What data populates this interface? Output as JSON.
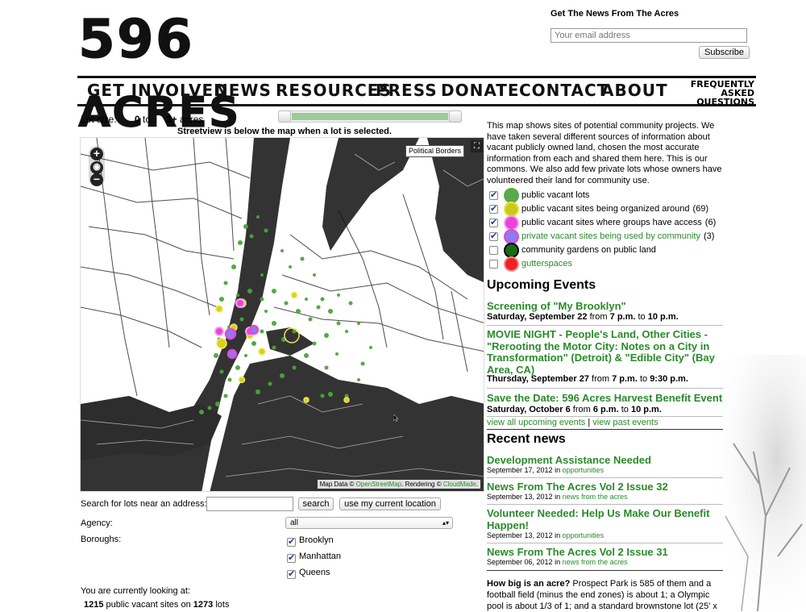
{
  "header": {
    "logo": {
      "number": "596",
      "word": "ACRES"
    },
    "newsletter_title": "Get The News From The Acres",
    "email_placeholder": "Your email address",
    "subscribe_label": "Subscribe"
  },
  "nav": {
    "items": [
      "GET INVOLVED",
      "NEWS",
      "RESOURCES",
      "PRESS",
      "DONATE",
      "CONTACT",
      "ABOUT"
    ],
    "faq_line1": "FREQUENTLY",
    "faq_line2": "ASKED QUESTIONS"
  },
  "lot_size": {
    "label": "Lot size:",
    "min_value": "0",
    "to_text": "to",
    "max_value": "3+",
    "units": "acres",
    "streetview_note": "Streetview is below the map when a lot is selected."
  },
  "map": {
    "political_borders_label": "Political Borders",
    "zoom_in": "+",
    "zoom_out": "−",
    "attribution_prefix": "Map Data ©",
    "attribution_osm": "OpenStreetMap",
    "attribution_mid": ". Rendering ©",
    "attribution_cloudmade": "CloudMade",
    "attribution_end": "."
  },
  "search": {
    "label": "Search for lots near an address:",
    "search_label": "search",
    "location_label": "use my current location"
  },
  "filters": {
    "agency_label": "Agency:",
    "agency_selected": "all",
    "boroughs_label": "Boroughs:",
    "boroughs": [
      "Brooklyn",
      "Manhattan",
      "Queens"
    ]
  },
  "status": {
    "looking_label": "You are currently looking at:",
    "sites_count": "1215",
    "sites_text": "public vacant sites on",
    "lots_count": "1273",
    "lots_text": "lots"
  },
  "intro": "This map shows sites of potential community projects. We have taken several different sources of information about vacant publicly owned land, chosen the most accurate information from each and shared them here. This is our commons. We also add few private lots whose owners have volunteered their land for community use.",
  "legend": [
    {
      "label": "public vacant lots",
      "count": "",
      "checked": true,
      "color": "#5aaa4a",
      "ring": "#5aaa4a",
      "link": false
    },
    {
      "label": "public vacant sites being organized around",
      "count": "(69)",
      "checked": true,
      "color": "#c8c81e",
      "ring": "#e8e23a",
      "link": false
    },
    {
      "label": "public vacant sites where groups have access",
      "count": "(6)",
      "checked": true,
      "color": "#e844d8",
      "ring": "#f5a2ee",
      "link": false
    },
    {
      "label": "private vacant sites being used by community",
      "count": "(3)",
      "checked": true,
      "color": "#8b7cf0",
      "ring": "#e844d8",
      "link": true
    },
    {
      "label": "community gardens on public land",
      "count": "",
      "checked": false,
      "color": "#1a6a1a",
      "ring": "#000000",
      "link": false
    },
    {
      "label": "gutterspaces",
      "count": "",
      "checked": false,
      "color": "#ee2222",
      "ring": "#f58a8a",
      "link": true
    }
  ],
  "events": {
    "title": "Upcoming Events",
    "items": [
      {
        "title": "Screening of \"My Brooklyn\"",
        "day": "Saturday, September 22",
        "from": "from",
        "start": "7 p.m.",
        "to": "to",
        "end": "10 p.m."
      },
      {
        "title": "MOVIE NIGHT - People's Land, Other Cities - \"Rerooting the Motor City: Notes on a City in Transformation\" (Detroit) & \"Edible City\" (Bay Area, CA)",
        "day": "Thursday, September 27",
        "from": "from",
        "start": "7 p.m.",
        "to": "to",
        "end": "9:30 p.m."
      },
      {
        "title": "Save the Date: 596 Acres Harvest Benefit Event",
        "day": "Saturday, October 6",
        "from": "from",
        "start": "6 p.m.",
        "to": "to",
        "end": "10 p.m."
      }
    ],
    "view_all": "view all upcoming events",
    "divider": "|",
    "view_past": "view past events"
  },
  "news": {
    "title": "Recent news",
    "in_text": "in",
    "items": [
      {
        "title": "Development Assistance Needed",
        "date": "September 17, 2012",
        "category": "opportunities"
      },
      {
        "title": "News From The Acres Vol 2 Issue 32",
        "date": "September 13, 2012",
        "category": "news from the acres"
      },
      {
        "title": "Volunteer Needed: Help Us Make Our Benefit Happen!",
        "date": "September 13, 2012",
        "category": "opportunities"
      },
      {
        "title": "News From The Acres Vol 2 Issue 31",
        "date": "September 06, 2012",
        "category": "news from the acres"
      }
    ]
  },
  "acre": {
    "question": "How big is an acre?",
    "answer": "Prospect Park is 585 of them and a football field (minus the end zones) is about 1; a Olympic pool is about 1/3 of 1; and a standard brownstone lot (25' x"
  }
}
